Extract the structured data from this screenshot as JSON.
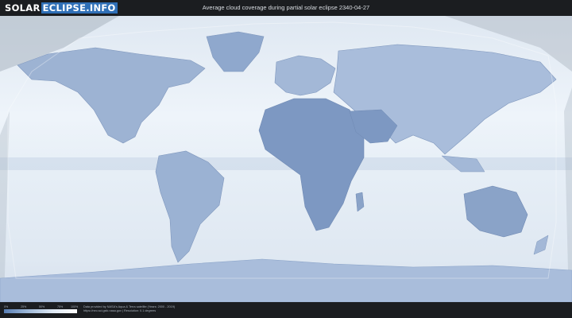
{
  "header": {
    "logo_primary": "SOLAR",
    "logo_secondary": "ECLIPSE.INFO",
    "title": "Average cloud coverage during partial solar eclipse 2340-04-27"
  },
  "legend": {
    "ticks": [
      "0%",
      "25%",
      "50%",
      "75%",
      "100%"
    ],
    "colors": [
      "#5a7fb5",
      "#9fb9d8",
      "#dfe9f4",
      "#ffffff"
    ]
  },
  "credits": {
    "line1": "Data provided by NASA's Aqua & Terra satellite (Years: 2000 - 2019)",
    "line2": "https://neo.sci.gsfc.nasa.gov | Resolution: 0.1 degrees"
  },
  "map": {
    "ocean_color": "#eaf1f8",
    "land_color": "#7d98c2",
    "night_shade": "#aab4bf"
  }
}
